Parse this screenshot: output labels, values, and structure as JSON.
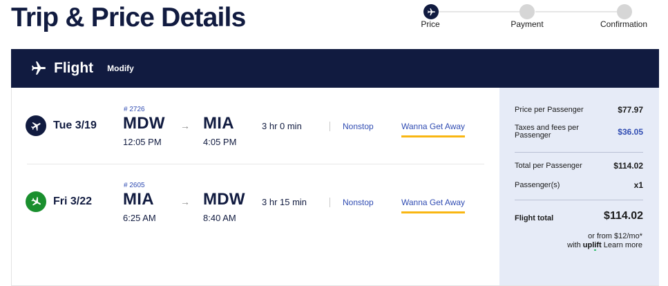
{
  "page": {
    "title": "Trip & Price Details"
  },
  "stepper": {
    "steps": [
      {
        "label": "Price",
        "active": true
      },
      {
        "label": "Payment",
        "active": false
      },
      {
        "label": "Confirmation",
        "active": false
      }
    ]
  },
  "flight_bar": {
    "title": "Flight",
    "modify_label": "Modify"
  },
  "flights": [
    {
      "date": "Tue 3/19",
      "flight_number": "# 2726",
      "depart_code": "MDW",
      "depart_time": "12:05 PM",
      "arrive_code": "MIA",
      "arrive_time": "4:05 PM",
      "arrow": "→",
      "duration": "3 hr 0 min",
      "stops": "Nonstop",
      "fare": "Wanna Get Away",
      "icon": "plane-departure-icon",
      "icon_color": "#111b40"
    },
    {
      "date": "Fri 3/22",
      "flight_number": "# 2605",
      "depart_code": "MIA",
      "depart_time": "6:25 AM",
      "arrive_code": "MDW",
      "arrive_time": "8:40 AM",
      "arrow": "→",
      "duration": "3 hr 15 min",
      "stops": "Nonstop",
      "fare": "Wanna Get Away",
      "icon": "plane-return-icon",
      "icon_color": "#1a8f2e"
    }
  ],
  "summary": {
    "price_per_passenger_label": "Price per Passenger",
    "price_per_passenger": "$77.97",
    "taxes_label": "Taxes and fees per Passenger",
    "taxes": "$36.05",
    "total_per_passenger_label": "Total per Passenger",
    "total_per_passenger": "$114.02",
    "passengers_label": "Passenger(s)",
    "passengers": "x1",
    "flight_total_label": "Flight total",
    "flight_total": "$114.02",
    "uplift_line1": "or from $12/mo*",
    "uplift_with": "with",
    "uplift_brand_a": "upl",
    "uplift_brand_b": "i",
    "uplift_brand_c": "ft",
    "learn_more": "Learn more"
  },
  "colors": {
    "navy": "#111b40",
    "link_blue": "#304cb2",
    "fare_underline": "#f9b612",
    "summary_bg": "#e6ebf7",
    "return_green": "#1a8f2e"
  }
}
